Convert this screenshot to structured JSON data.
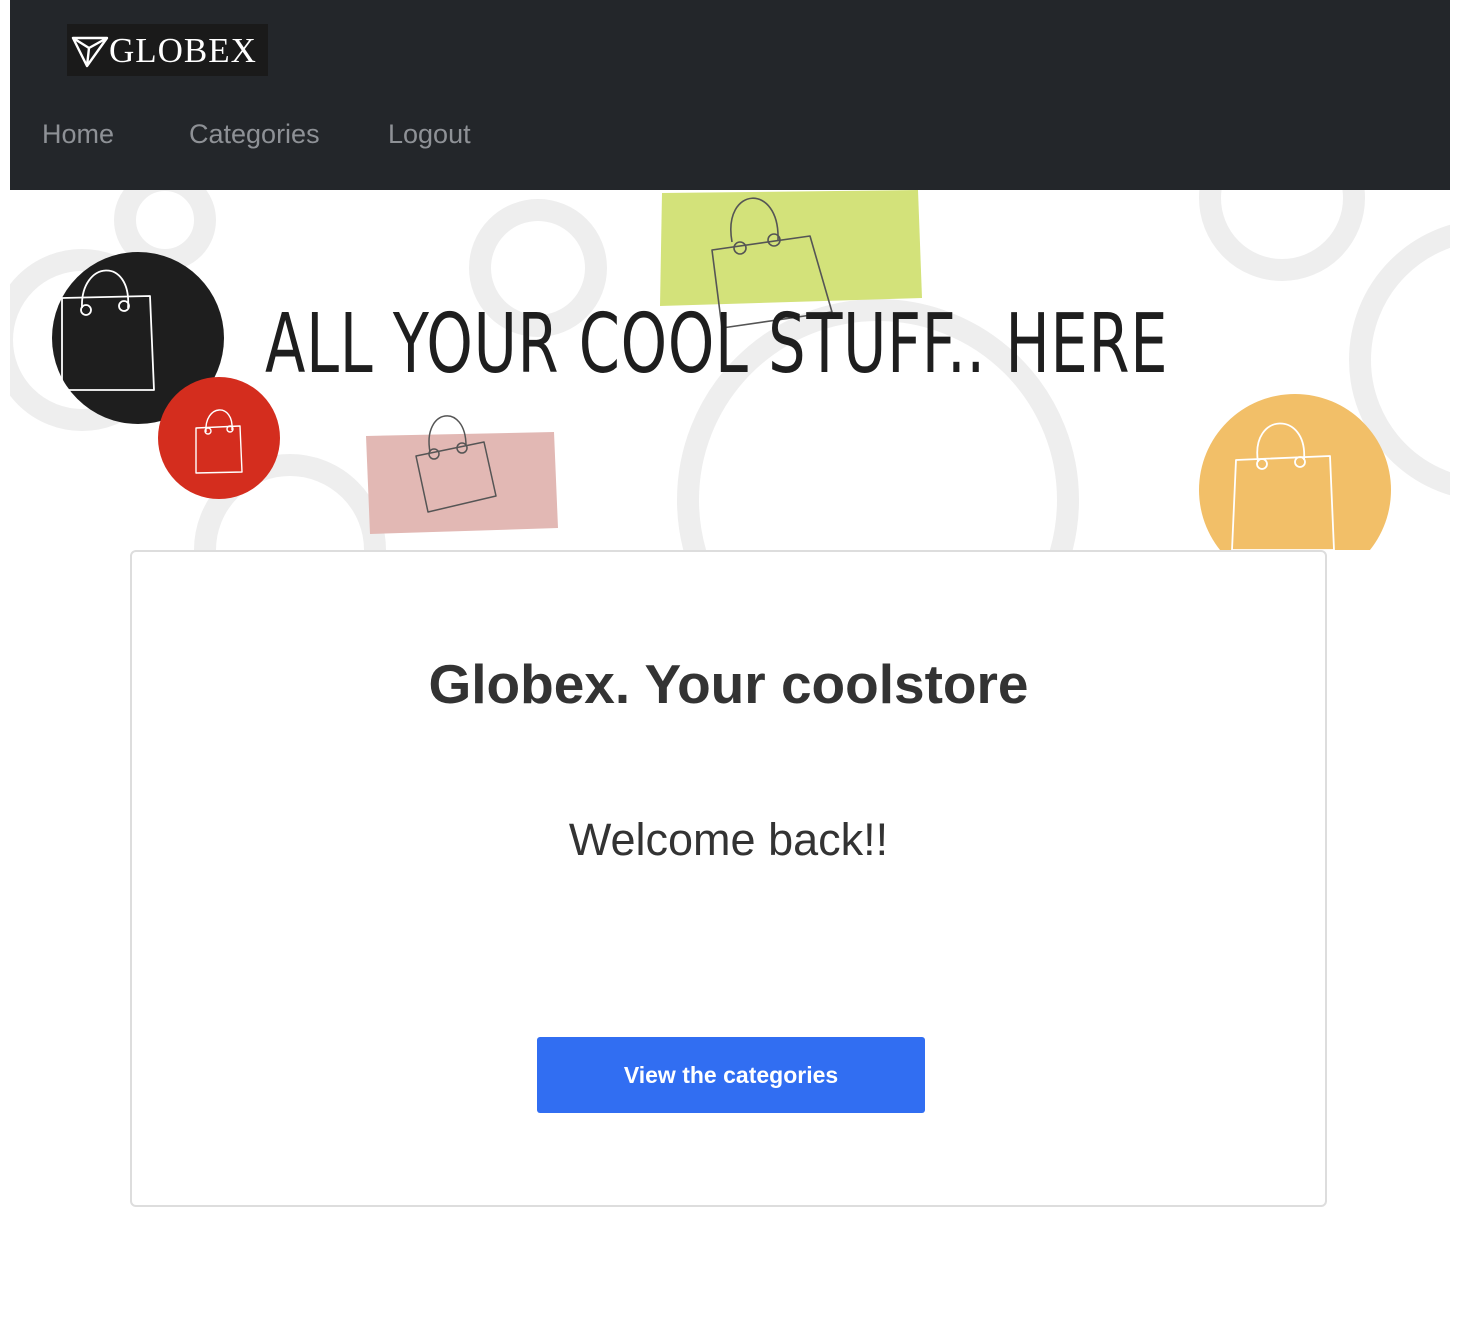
{
  "brand": {
    "name": "GLOBEX"
  },
  "nav": {
    "items": [
      {
        "label": "Home"
      },
      {
        "label": "Categories"
      },
      {
        "label": "Logout"
      }
    ]
  },
  "hero": {
    "headline": "ALL YOUR COOL STUFF.. HERE",
    "icons": [
      "shopping-bag-icon"
    ]
  },
  "main": {
    "title": "Globex. Your coolstore",
    "welcome": "Welcome back!!",
    "cta_label": "View the categories"
  },
  "colors": {
    "navbar_bg": "#23262a",
    "nav_text": "#8e9196",
    "cta_bg": "#316ef2",
    "circle_black": "#1e1e1e",
    "circle_red": "#d42d1e",
    "swatch_green": "#d3e27a",
    "swatch_pink": "#e2b8b4",
    "circle_orange": "#f2bf68"
  }
}
